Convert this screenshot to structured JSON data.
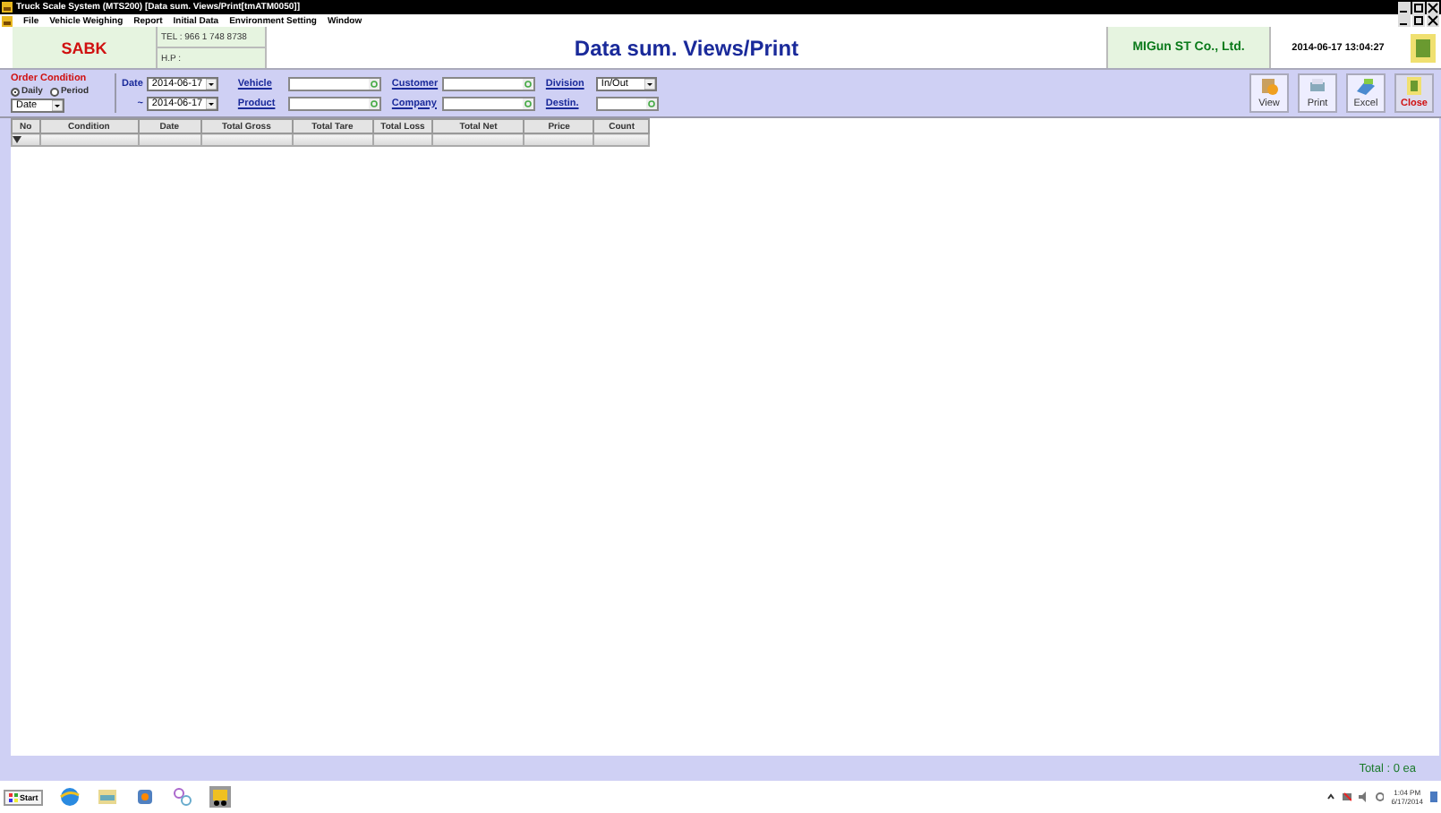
{
  "window": {
    "title": "Truck Scale System (MTS200)   [Data sum. Views/Print[tmATM0050]]"
  },
  "menu": [
    "File",
    "Vehicle Weighing",
    "Report",
    "Initial Data",
    "Environment Setting",
    "Window"
  ],
  "header": {
    "logo": "SABK",
    "tel": "TEL : 966 1 748 8738",
    "hp": "H.P :",
    "title": "Data sum. Views/Print",
    "company": "MIGun ST Co., Ltd.",
    "datetime": "2014-06-17 13:04:27"
  },
  "filter": {
    "order_label": "Order Condition",
    "radios": [
      {
        "label": "Daily",
        "selected": true
      },
      {
        "label": "Period",
        "selected": false
      }
    ],
    "order_select": "Date",
    "date_label": "Date",
    "date_from": "2014-06-17",
    "range_sign": "~",
    "date_to": "2014-06-17",
    "fields": [
      {
        "label": "Vehicle",
        "kind": "lookup"
      },
      {
        "label": "Product",
        "kind": "lookup"
      },
      {
        "label": "Customer",
        "kind": "lookup"
      },
      {
        "label": "Company",
        "kind": "lookup"
      },
      {
        "label": "Division",
        "kind": "select",
        "value": "In/Out"
      },
      {
        "label": "Destin.",
        "kind": "lookup"
      }
    ]
  },
  "buttons": [
    {
      "label": "View",
      "kind": "view"
    },
    {
      "label": "Print",
      "kind": "print"
    },
    {
      "label": "Excel",
      "kind": "excel"
    },
    {
      "label": "Close",
      "kind": "close"
    }
  ],
  "table": {
    "columns": [
      "No",
      "Condition",
      "Date",
      "Total Gross",
      "Total Tare",
      "Total Loss",
      "Total Net",
      "Price",
      "Count"
    ]
  },
  "status_bar": {
    "total": "Total : 0 ea"
  },
  "taskbar": {
    "start": "Start",
    "time": "1:04 PM",
    "date": "6/17/2014"
  }
}
